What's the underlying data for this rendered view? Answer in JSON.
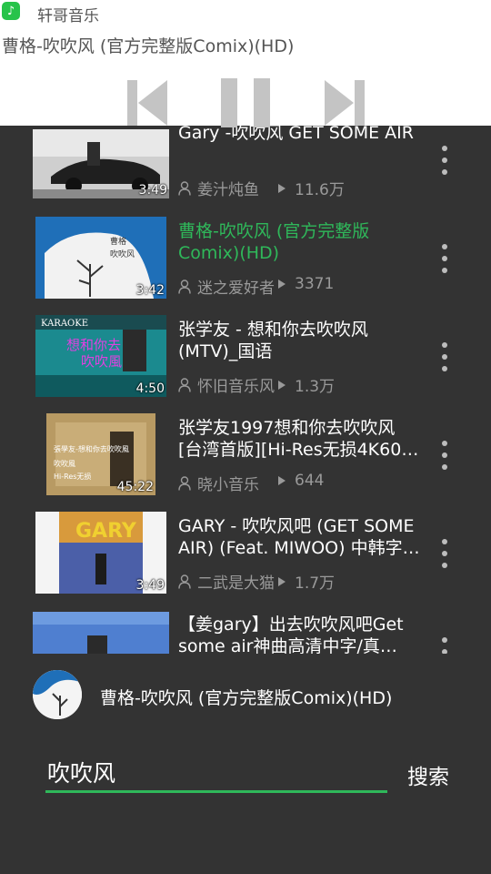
{
  "notification": {
    "app_name": "轩哥音乐",
    "now_playing_title": "曹格-吹吹风 (官方完整版Comix)(HD)",
    "icon": "music-note-icon"
  },
  "controls": {
    "previous_icon": "skip-previous-icon",
    "pause_icon": "pause-icon",
    "next_icon": "skip-next-icon"
  },
  "videos": [
    {
      "title": "Gary -吹吹风 GET SOME AIR",
      "author": "姜汁炖鱼",
      "views": "11.6万",
      "duration": "3:49",
      "active": false
    },
    {
      "title": "曹格-吹吹风 (官方完整版Comix)(HD)",
      "title_line1": "曹格-吹吹风 (官方完整版",
      "title_line2": "Comix)(HD)",
      "author": "迷之爱好者",
      "views": "3371",
      "duration": "3:42",
      "active": true
    },
    {
      "title_line1": "张学友 - 想和你去吹吹风",
      "title_line2": "(MTV)_国语",
      "author": "怀旧音乐风",
      "views": "1.3万",
      "duration": "4:50",
      "thumb_caption": "KARAOKE",
      "active": false
    },
    {
      "title_line1": "张学友1997想和你去吹吹风",
      "title_line2": "[台湾首版][Hi-Res无损4K60…",
      "author": "晓小音乐",
      "views": "644",
      "duration": "45:22",
      "active": false
    },
    {
      "title_line1": "GARY - 吹吹风吧 (GET SOME",
      "title_line2": "AIR) (Feat. MIWOO) 中韩字…",
      "author": "二武是大猫",
      "views": "1.7万",
      "duration": "3:49",
      "thumb_caption": "GARY",
      "active": false
    },
    {
      "title_line1": "【姜gary】出去吹吹风吧Get",
      "title_line2": "some air神曲高清中字/真…",
      "active": false
    }
  ],
  "now_playing_bar": {
    "title": "曹格-吹吹风 (官方完整版Comix)(HD)"
  },
  "search": {
    "value": "吹吹风",
    "button_label": "搜索"
  },
  "colors": {
    "accent": "#2fb85a",
    "background": "#333333",
    "notification_bg": "#ffffff"
  }
}
